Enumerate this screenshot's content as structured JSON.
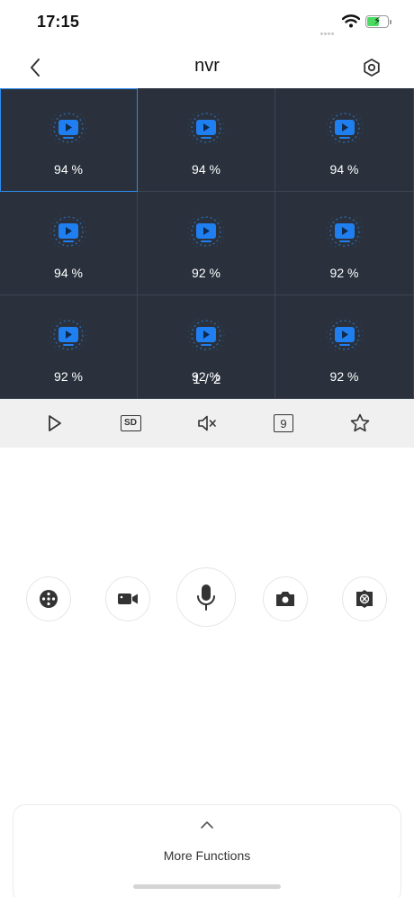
{
  "status_bar": {
    "time": "17:15"
  },
  "nav": {
    "title": "nvr"
  },
  "grid": {
    "cells": [
      {
        "percent": "94 %",
        "selected": true
      },
      {
        "percent": "94 %",
        "selected": false
      },
      {
        "percent": "94 %",
        "selected": false
      },
      {
        "percent": "94 %",
        "selected": false
      },
      {
        "percent": "92 %",
        "selected": false
      },
      {
        "percent": "92 %",
        "selected": false
      },
      {
        "percent": "92 %",
        "selected": false
      },
      {
        "percent": "92 %",
        "selected": false
      },
      {
        "percent": "92 %",
        "selected": false
      }
    ],
    "page_indicator": "1 / 2"
  },
  "toolbar": {
    "quality_label": "SD",
    "split_label": "9",
    "items": [
      "play-icon",
      "sd-quality-icon",
      "mute-icon",
      "split-screen-icon",
      "favorite-star-icon"
    ]
  },
  "controls": {
    "items": [
      "ptz-control-icon",
      "record-video-icon",
      "microphone-icon",
      "snapshot-camera-icon",
      "fisheye-icon"
    ]
  },
  "more": {
    "label": "More Functions"
  },
  "colors": {
    "grid_background": "#2a313c",
    "accent": "#2d8cf0",
    "toolbar_background": "#f0f0f0"
  }
}
